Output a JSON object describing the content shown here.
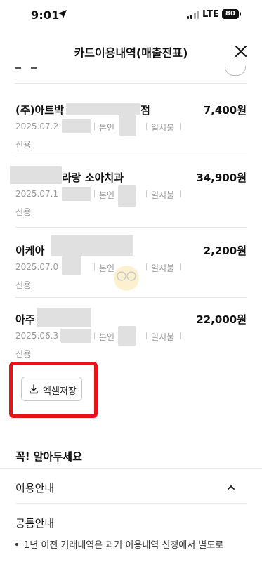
{
  "status_bar": {
    "time": "9:01",
    "network": "LTE",
    "battery": "80"
  },
  "header": {
    "title": "카드이용내역(매출전표)"
  },
  "transactions": [
    {
      "merchant": "(주)아트박",
      "merchant_suffix": "점",
      "amount": "7,400원",
      "date": "2025.07.2",
      "owner": "본인",
      "payment": "일시불",
      "kind": "신용"
    },
    {
      "merchant": "",
      "merchant_suffix": "라랑 소아치과",
      "amount": "34,900원",
      "date": "2025.07.1",
      "owner": "본인",
      "payment": "일시불",
      "kind": "신용"
    },
    {
      "merchant": "이케아",
      "merchant_suffix": "",
      "amount": "2,200원",
      "date": "2025.07.0",
      "owner": "본인",
      "payment": "일시불",
      "kind": "신용"
    },
    {
      "merchant": "아주",
      "merchant_suffix": "",
      "amount": "22,000원",
      "date": "2025.06.3",
      "owner": "본인",
      "payment": "일시불",
      "kind": "신용"
    }
  ],
  "actions": {
    "excel_save_label": "엑셀저장"
  },
  "notice": {
    "title": "꼭! 알아두세요",
    "usage_info_label": "이용안내",
    "common_info_label": "공통안내",
    "bullet_text": "1년 이전 거래내역은 과거 이용내역 신청에서 별도로"
  },
  "colors": {
    "highlight": "#e8121a",
    "muted_text": "#999999"
  },
  "icons": [
    "location-arrow-icon",
    "signal-icon",
    "battery-icon",
    "close-icon",
    "more-icon",
    "download-icon",
    "chevron-up-icon"
  ]
}
